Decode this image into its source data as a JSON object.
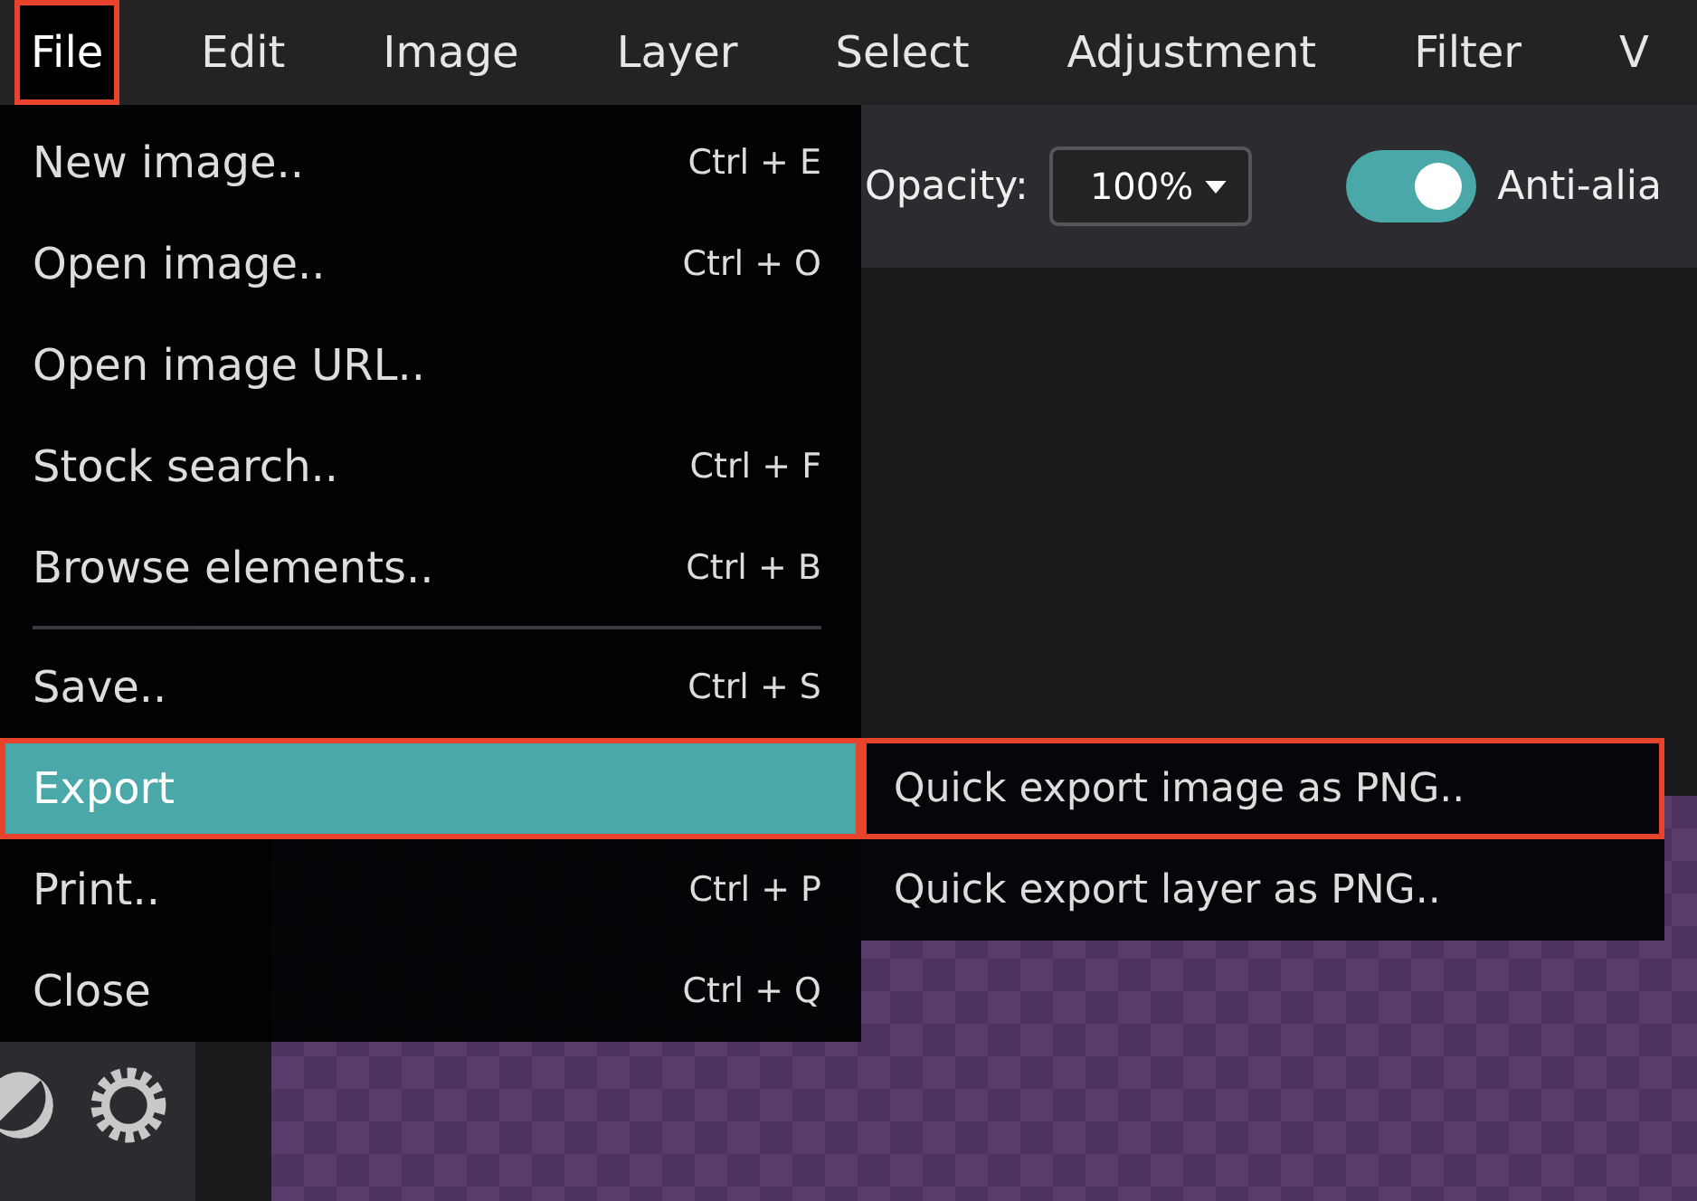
{
  "menubar": [
    {
      "label": "File",
      "selected": true,
      "highlighted": true
    },
    {
      "label": "Edit",
      "selected": false,
      "highlighted": false
    },
    {
      "label": "Image",
      "selected": false,
      "highlighted": false
    },
    {
      "label": "Layer",
      "selected": false,
      "highlighted": false
    },
    {
      "label": "Select",
      "selected": false,
      "highlighted": false
    },
    {
      "label": "Adjustment",
      "selected": false,
      "highlighted": false
    },
    {
      "label": "Filter",
      "selected": false,
      "highlighted": false
    },
    {
      "label": "V",
      "selected": false,
      "highlighted": false
    }
  ],
  "toolbar": {
    "opacity_label": "Opacity:",
    "opacity_value": "100%",
    "antialias": {
      "label": "Anti-alia",
      "on": true
    }
  },
  "file_menu": [
    {
      "kind": "item",
      "label": "New image..",
      "shortcut": "Ctrl + E",
      "selected": false,
      "highlighted": false
    },
    {
      "kind": "item",
      "label": "Open image..",
      "shortcut": "Ctrl + O",
      "selected": false,
      "highlighted": false
    },
    {
      "kind": "item",
      "label": "Open image URL..",
      "selected": false,
      "highlighted": false
    },
    {
      "kind": "item",
      "label": "Stock search..",
      "shortcut": "Ctrl + F",
      "selected": false,
      "highlighted": false
    },
    {
      "kind": "item",
      "label": "Browse elements..",
      "shortcut": "Ctrl + B",
      "selected": false,
      "highlighted": false
    },
    {
      "kind": "divider"
    },
    {
      "kind": "item",
      "label": "Save..",
      "shortcut": "Ctrl + S",
      "selected": false,
      "highlighted": false
    },
    {
      "kind": "submenu",
      "label": "Export",
      "selected": true,
      "highlighted": true,
      "children": [
        {
          "label": "Quick export image as PNG..",
          "highlighted": true
        },
        {
          "label": "Quick export layer as PNG..",
          "highlighted": false
        }
      ]
    },
    {
      "kind": "item",
      "label": "Print..",
      "shortcut": "Ctrl + P",
      "selected": false,
      "highlighted": false
    },
    {
      "kind": "item",
      "label": "Close",
      "shortcut": "Ctrl + Q",
      "selected": false,
      "highlighted": false
    }
  ]
}
